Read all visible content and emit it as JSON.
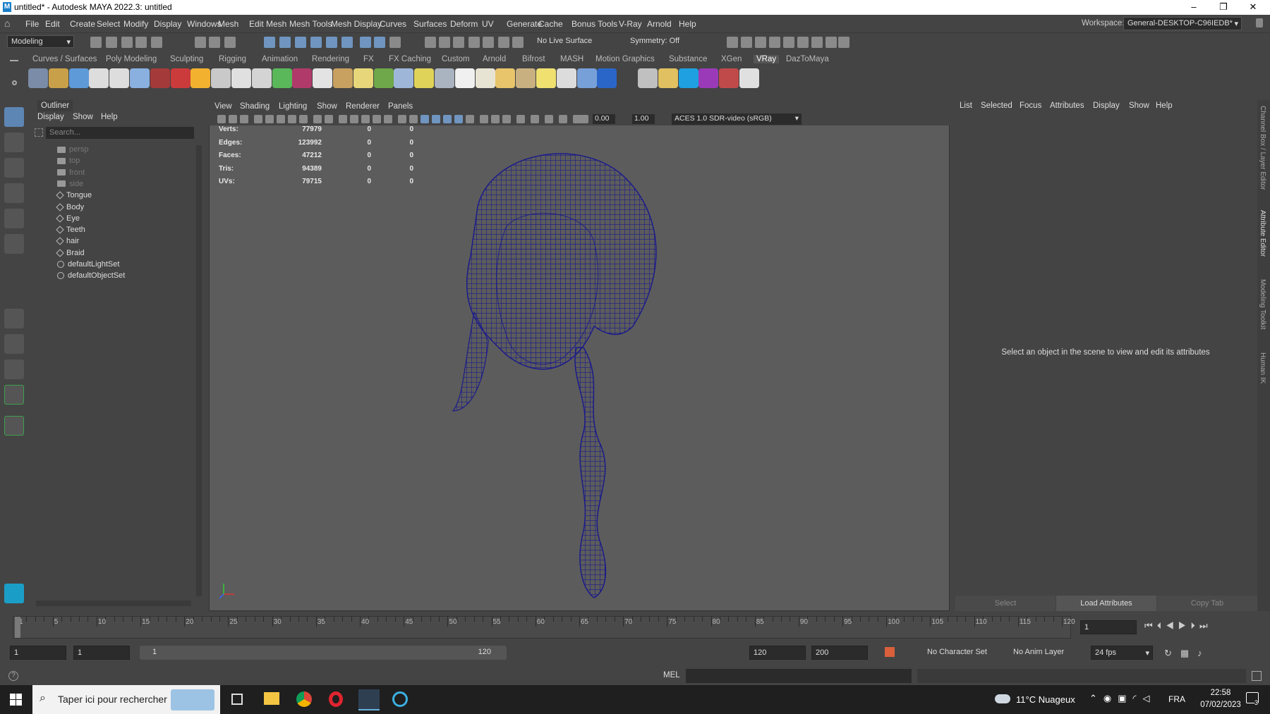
{
  "window": {
    "title": "untitled* - Autodesk MAYA 2022.3: untitled"
  },
  "menus": [
    "File",
    "Edit",
    "Create",
    "Select",
    "Modify",
    "Display",
    "Windows",
    "Mesh",
    "Edit Mesh",
    "Mesh Tools",
    "Mesh Display",
    "Curves",
    "Surfaces",
    "Deform",
    "UV",
    "Generate",
    "Cache",
    "Bonus Tools",
    "V-Ray",
    "Arnold",
    "Help"
  ],
  "workspace": {
    "label": "Workspace:",
    "value": "General-DESKTOP-C96IEDB*"
  },
  "toolbar": {
    "mode": "Modeling",
    "live_surface": "No Live Surface",
    "symmetry": "Symmetry: Off"
  },
  "shelf_tabs": [
    "Curves / Surfaces",
    "Poly Modeling",
    "Sculpting",
    "Rigging",
    "Animation",
    "Rendering",
    "FX",
    "FX Caching",
    "Custom",
    "Arnold",
    "Bifrost",
    "MASH",
    "Motion Graphics",
    "Substance",
    "XGen",
    "VRay",
    "DazToMaya"
  ],
  "shelf_active": "VRay",
  "outliner": {
    "title": "Outliner",
    "menu": [
      "Display",
      "Show",
      "Help"
    ],
    "search_placeholder": "Search...",
    "items": [
      {
        "label": "persp",
        "kind": "camera",
        "dim": true
      },
      {
        "label": "top",
        "kind": "camera",
        "dim": true
      },
      {
        "label": "front",
        "kind": "camera",
        "dim": true
      },
      {
        "label": "side",
        "kind": "camera",
        "dim": true
      },
      {
        "label": "Tongue",
        "kind": "mesh",
        "dim": false
      },
      {
        "label": "Body",
        "kind": "mesh",
        "dim": false
      },
      {
        "label": "Eye",
        "kind": "mesh",
        "dim": false
      },
      {
        "label": "Teeth",
        "kind": "mesh",
        "dim": false
      },
      {
        "label": "hair",
        "kind": "mesh",
        "dim": false
      },
      {
        "label": "Braid",
        "kind": "mesh",
        "dim": false
      },
      {
        "label": "defaultLightSet",
        "kind": "set",
        "dim": false
      },
      {
        "label": "defaultObjectSet",
        "kind": "set",
        "dim": false
      }
    ]
  },
  "viewport": {
    "menu": [
      "View",
      "Shading",
      "Lighting",
      "Show",
      "Renderer",
      "Panels"
    ],
    "exposure": "0.00",
    "gamma": "1.00",
    "colorspace": "ACES 1.0 SDR-video (sRGB)",
    "hud": [
      {
        "label": "Verts:",
        "a": "77979",
        "b": "0",
        "c": "0"
      },
      {
        "label": "Edges:",
        "a": "123992",
        "b": "0",
        "c": "0"
      },
      {
        "label": "Faces:",
        "a": "47212",
        "b": "0",
        "c": "0"
      },
      {
        "label": "Tris:",
        "a": "94389",
        "b": "0",
        "c": "0"
      },
      {
        "label": "UVs:",
        "a": "79715",
        "b": "0",
        "c": "0"
      }
    ]
  },
  "attribute_editor": {
    "menu": [
      "List",
      "Selected",
      "Focus",
      "Attributes",
      "Display",
      "Show",
      "Help"
    ],
    "message": "Select an object in the scene to view and edit its attributes",
    "buttons": [
      "Select",
      "Load Attributes",
      "Copy Tab"
    ]
  },
  "side_tabs": [
    "Channel Box / Layer Editor",
    "Attribute Editor",
    "Modeling Toolkit",
    "Human IK"
  ],
  "timeline": {
    "ticks": [
      "1",
      "5",
      "10",
      "15",
      "20",
      "25",
      "30",
      "35",
      "40",
      "45",
      "50",
      "55",
      "60",
      "65",
      "70",
      "75",
      "80",
      "85",
      "90",
      "95",
      "100",
      "105",
      "110",
      "115",
      "120"
    ],
    "current_frame": "1"
  },
  "range": {
    "start": "1",
    "playback_start": "1",
    "slider_start": "1",
    "slider_end": "120",
    "playback_end": "120",
    "end": "200",
    "character_set": "No Character Set",
    "anim_layer": "No Anim Layer",
    "fps": "24 fps"
  },
  "command": {
    "lang": "MEL"
  },
  "taskbar": {
    "search": "Taper ici pour rechercher",
    "weather": "11°C Nuageux",
    "lang": "FRA",
    "time": "22:58",
    "date": "07/02/2023",
    "notif": "3"
  }
}
